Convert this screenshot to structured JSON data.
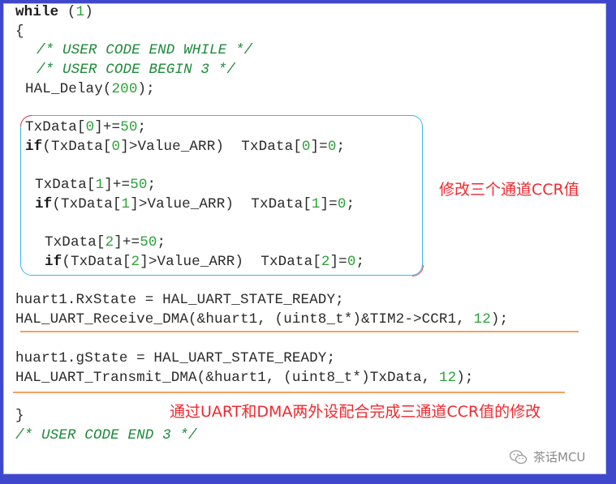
{
  "code": {
    "line_while": {
      "kw": "while",
      "open": " (",
      "num": "1",
      "close": ")"
    },
    "line_brace_open": "{",
    "comment_end_while": "/* USER CODE END WHILE */",
    "comment_begin_3": "/* USER CODE BEGIN 3 */",
    "delay": {
      "pre": "HAL_Delay(",
      "num": "200",
      "post": ");"
    },
    "channels": [
      {
        "inc_pre": "TxData[",
        "idx": "0",
        "inc_mid": "]+=",
        "inc_val": "50",
        "inc_post": ";",
        "if_kw": "if",
        "if_a": "(TxData[",
        "if_b": "]>Value_ARR)  TxData[",
        "if_c": "]=",
        "zero": "0",
        "if_d": ";"
      },
      {
        "inc_pre": "TxData[",
        "idx": "1",
        "inc_mid": "]+=",
        "inc_val": "50",
        "inc_post": ";",
        "if_kw": "if",
        "if_a": "(TxData[",
        "if_b": "]>Value_ARR)  TxData[",
        "if_c": "]=",
        "zero": "0",
        "if_d": ";"
      },
      {
        "inc_pre": "TxData[",
        "idx": "2",
        "inc_mid": "]+=",
        "inc_val": "50",
        "inc_post": ";",
        "if_kw": "if",
        "if_a": "(TxData[",
        "if_b": "]>Value_ARR)  TxData[",
        "if_c": "]=",
        "zero": "0",
        "if_d": ";"
      }
    ],
    "rx_state": "huart1.RxState = HAL_UART_STATE_READY;",
    "rx_dma": {
      "pre": "HAL_UART_Receive_DMA(&huart1, (uint8_t*)&TIM2->CCR1, ",
      "num": "12",
      "post": ");"
    },
    "g_state": "huart1.gState = HAL_UART_STATE_READY;",
    "tx_dma": {
      "pre": "HAL_UART_Transmit_DMA(&huart1, (uint8_t*)TxData, ",
      "num": "12",
      "post": ");"
    },
    "line_brace_close": "}",
    "comment_end_3": "/* USER CODE END 3 */"
  },
  "annotations": {
    "box_note": "修改三个通道CCR值",
    "bottom_note": "通过UART和DMA两外设配合完成三通道CCR值的修改"
  },
  "watermark": {
    "icon": "wechat-icon",
    "text": "茶话MCU"
  },
  "colors": {
    "frame": "#3f48cc",
    "box_border": "#3fb6ea",
    "box_corner": "#e84048",
    "underline": "#f4a060",
    "note": "#f0282e",
    "number": "#2aa236",
    "comment": "#1f8a3a"
  }
}
